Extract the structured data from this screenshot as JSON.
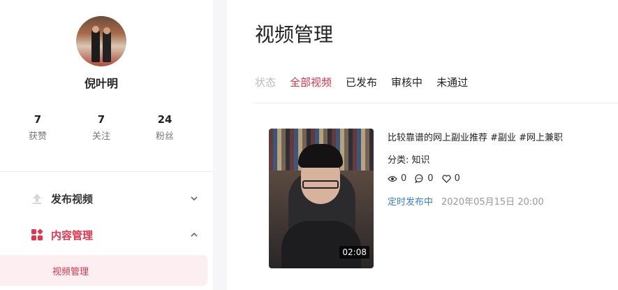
{
  "profile": {
    "name": "倪叶明",
    "stats": [
      {
        "num": "7",
        "label": "获赞"
      },
      {
        "num": "7",
        "label": "关注"
      },
      {
        "num": "24",
        "label": "粉丝"
      }
    ]
  },
  "nav": {
    "publish_label": "发布视频",
    "content_label": "内容管理",
    "sub_video_label": "视频管理"
  },
  "main": {
    "title": "视频管理",
    "status_label": "状态",
    "tabs": [
      "全部视频",
      "已发布",
      "审核中",
      "未通过"
    ]
  },
  "video": {
    "title": "比较靠谱的网上副业推荐 #副业 #网上兼职",
    "category": "分类: 知识",
    "views": "0",
    "comments": "0",
    "likes": "0",
    "status": "定时发布中",
    "time": "2020年05月15日 20:00",
    "duration": "02:08"
  },
  "colors": {
    "accent": "#e8334a",
    "link": "#3b7ee0"
  }
}
